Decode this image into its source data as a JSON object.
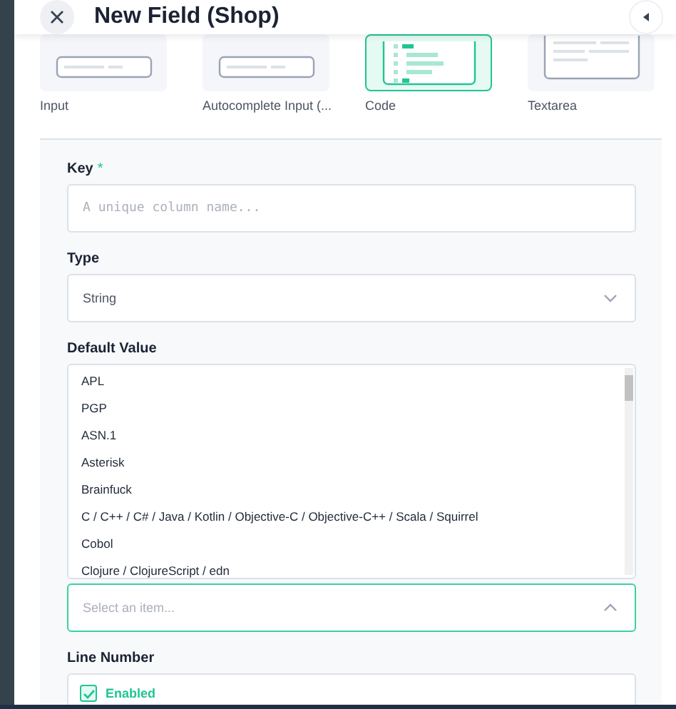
{
  "header": {
    "title": "New Field (Shop)"
  },
  "field_types": [
    {
      "label": "Input",
      "kind": "input",
      "selected": false
    },
    {
      "label": "Autocomplete Input (...",
      "kind": "input",
      "selected": false
    },
    {
      "label": "Code",
      "kind": "code",
      "selected": true
    },
    {
      "label": "Textarea",
      "kind": "textarea",
      "selected": false
    }
  ],
  "form": {
    "key": {
      "label": "Key",
      "required_mark": "*",
      "placeholder": "A unique column name..."
    },
    "type": {
      "label": "Type",
      "value": "String"
    },
    "default_value": {
      "label": "Default Value",
      "expanded": true,
      "placeholder": "Select an item...",
      "options": [
        "APL",
        "PGP",
        "ASN.1",
        "Asterisk",
        "Brainfuck",
        "C / C++ / C# / Java / Kotlin / Objective-C / Objective-C++ / Scala / Squirrel",
        "Cobol",
        "Clojure / ClojureScript / edn"
      ]
    },
    "line_number": {
      "label": "Line Number",
      "option": "Enabled",
      "checked": true
    }
  }
}
